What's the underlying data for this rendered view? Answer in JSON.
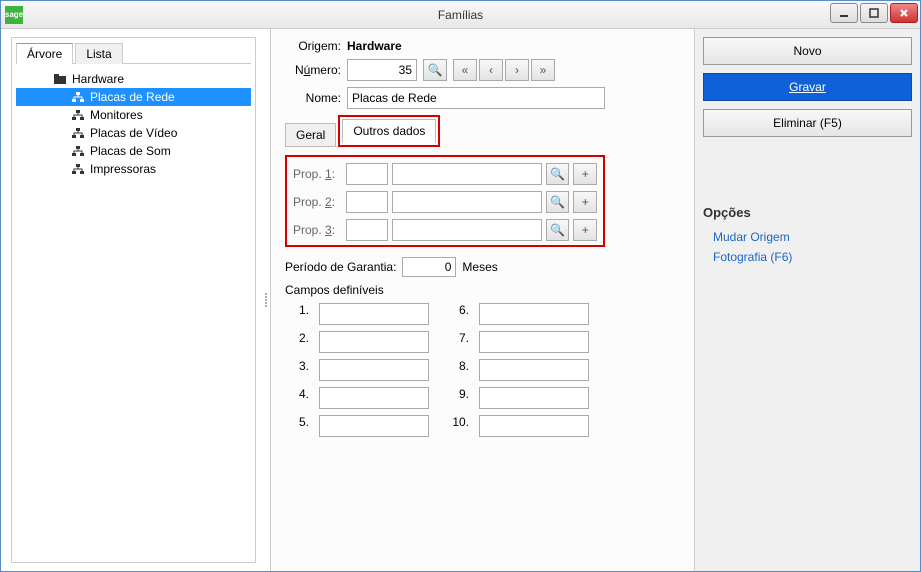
{
  "app": {
    "icon_text": "sage",
    "title": "Famílias"
  },
  "window_controls": {
    "min": "−",
    "max": "□",
    "close": "✕"
  },
  "left": {
    "tabs": [
      "Árvore",
      "Lista"
    ],
    "active_tab": 0,
    "tree": {
      "root": "Hardware",
      "children": [
        "Placas de Rede",
        "Monitores",
        "Placas de Vídeo",
        "Placas de Som",
        "Impressoras"
      ],
      "selected_index": 0
    }
  },
  "center": {
    "origem_label": "Origem:",
    "origem_value": "Hardware",
    "numero_label_pre": "N",
    "numero_label_u": "ú",
    "numero_label_post": "mero:",
    "numero_value": "35",
    "nome_label": "Nome:",
    "nome_value": "Placas de Rede",
    "nav_icons": {
      "search": "🔍",
      "first": "«",
      "prev": "‹",
      "next": "›",
      "last": "»"
    },
    "sub_tabs": [
      "Geral",
      "Outros dados"
    ],
    "active_sub_tab": 1,
    "props": [
      {
        "pre": "Prop. ",
        "u": "1",
        "post": ":"
      },
      {
        "pre": "Prop. ",
        "u": "2",
        "post": ":"
      },
      {
        "pre": "Prop. ",
        "u": "3",
        "post": ":"
      }
    ],
    "prop_icons": {
      "search": "🔍",
      "add": "+"
    },
    "garantia_label": "Período de Garantia:",
    "garantia_value": "0",
    "garantia_unit": "Meses",
    "campos_title": "Campos definíveis",
    "campos_nums_left": [
      "1.",
      "2.",
      "3.",
      "4.",
      "5."
    ],
    "campos_nums_right": [
      "6.",
      "7.",
      "8.",
      "9.",
      "10."
    ]
  },
  "right": {
    "novo": "Novo",
    "gravar": "Gravar",
    "eliminar": "Eliminar (F5)",
    "options_title": "Opções",
    "links": [
      "Mudar Origem",
      "Fotografia (F6)"
    ]
  }
}
